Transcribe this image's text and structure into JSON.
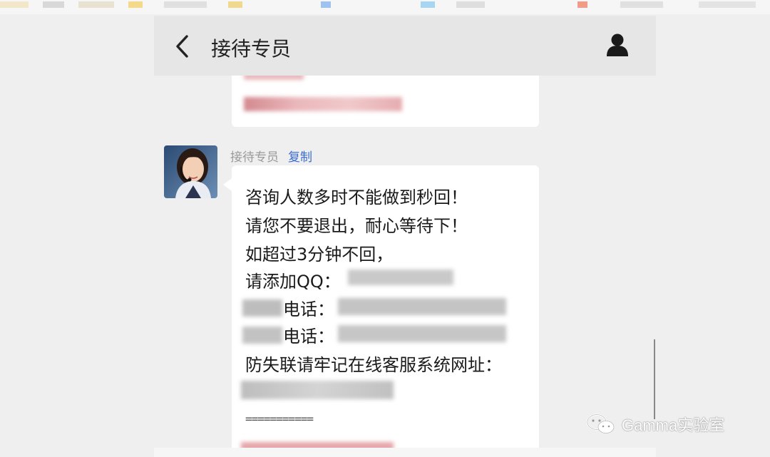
{
  "header": {
    "title": "接待专员"
  },
  "icons": {
    "back": "chevron-left-icon",
    "user": "user-icon",
    "watermark": "wechat-logo-icon"
  },
  "message": {
    "sender": "接待专员",
    "copy_label": "复制",
    "lines": [
      "咨询人数多时不能做到秒回！",
      "请您不要退出，耐心等待下！",
      "如超过3分钟不回，",
      "请添加QQ：",
      "电话：",
      "电话：",
      "防失联请牢记在线客服系统网址："
    ],
    "separator": "==========="
  },
  "watermark": {
    "text": "Gamma实验室"
  },
  "colors": {
    "header_bg": "#e6e6e6",
    "page_bg": "#efefef",
    "link": "#3b6ed1",
    "bubble": "#ffffff"
  }
}
